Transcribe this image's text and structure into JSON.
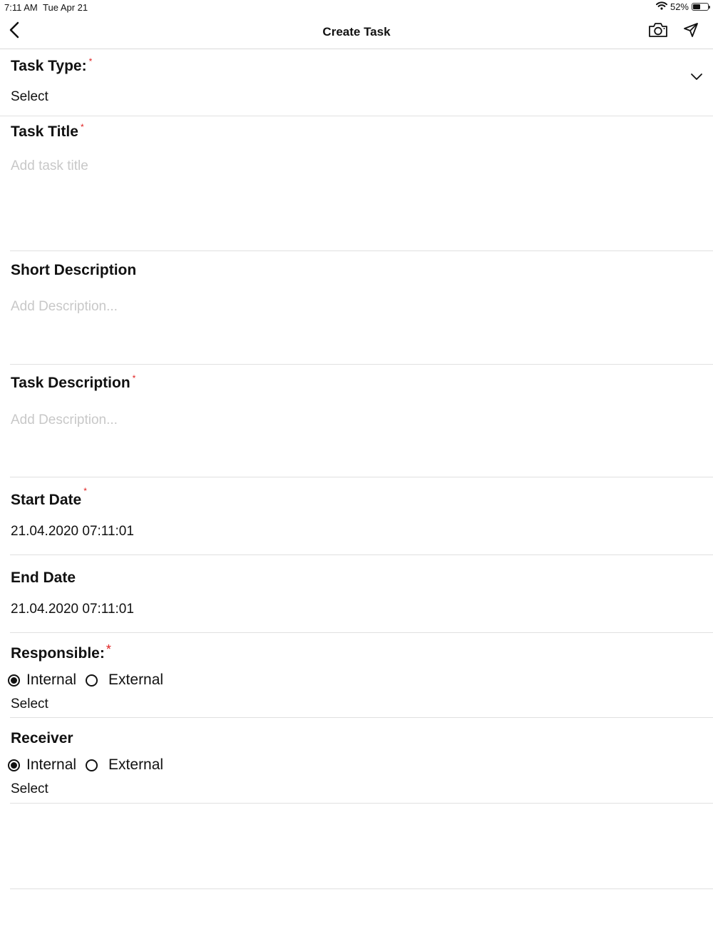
{
  "status_bar": {
    "time": "7:11 AM",
    "date": "Tue Apr 21",
    "battery": "52%",
    "battery_level": 0.52
  },
  "nav": {
    "title": "Create Task"
  },
  "form": {
    "task_type": {
      "label": "Task Type:",
      "placeholder": "Select"
    },
    "task_title": {
      "label": "Task Title",
      "placeholder": "Add task title"
    },
    "short_description": {
      "label": "Short Description",
      "placeholder": "Add Description..."
    },
    "task_description": {
      "label": "Task Description",
      "placeholder": "Add Description..."
    },
    "start_date": {
      "label": "Start Date",
      "value": "21.04.2020 07:11:01"
    },
    "end_date": {
      "label": "End Date",
      "value": "21.04.2020 07:11:01"
    },
    "responsible": {
      "label": "Responsible:",
      "option_internal": "Internal",
      "option_external": "External",
      "selected": "Internal",
      "select_label": "Select"
    },
    "receiver": {
      "label": "Receiver",
      "option_internal": "Internal",
      "option_external": "External",
      "selected": "Internal",
      "select_label": "Select"
    },
    "required_marker": "*"
  },
  "colors": {
    "required": "#e02020",
    "placeholder": "#c8c8c8",
    "divider": "#e0e0e0"
  },
  "icons": {
    "back": "chevron-left-icon",
    "camera": "camera-icon",
    "send": "send-icon",
    "dropdown": "chevron-down-icon",
    "wifi": "wifi-icon",
    "battery": "battery-icon"
  }
}
